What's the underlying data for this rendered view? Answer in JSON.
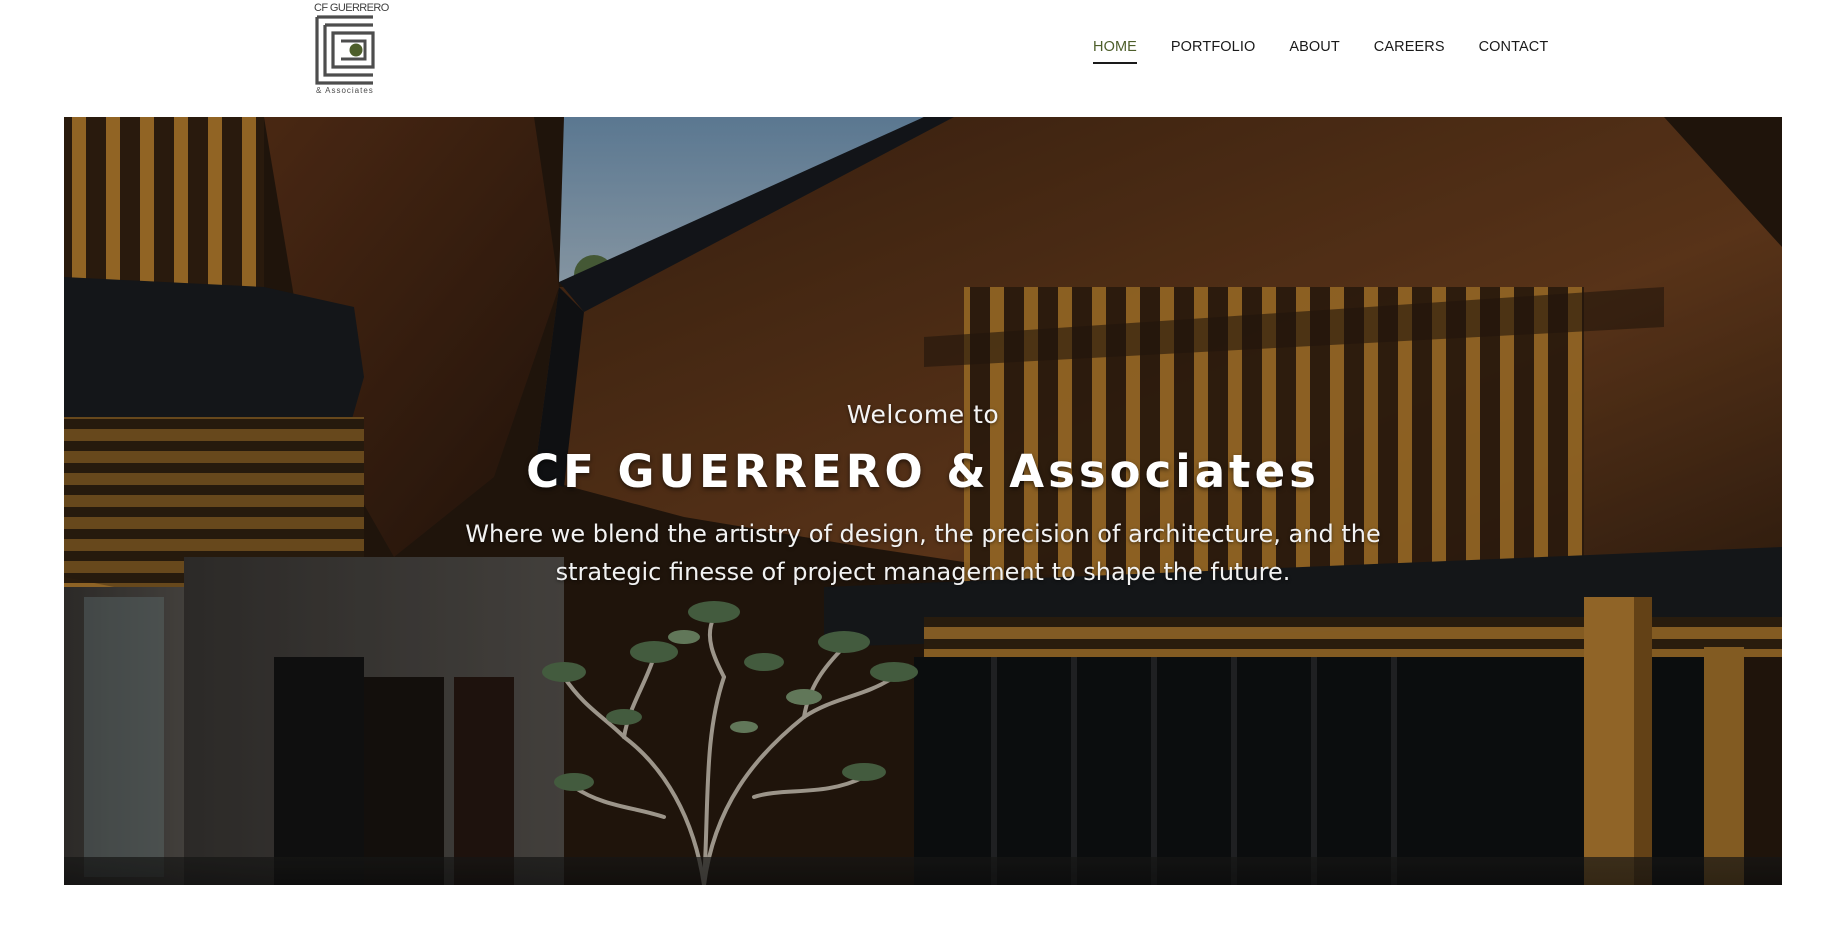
{
  "logo": {
    "top_text": "CF GUERRERO",
    "bottom_text": "& Associates",
    "mark_color": "#4d4d4d",
    "accent_color": "#4d5e2a"
  },
  "nav": {
    "items": [
      {
        "label": "HOME",
        "active": true
      },
      {
        "label": "PORTFOLIO",
        "active": false
      },
      {
        "label": "ABOUT",
        "active": false
      },
      {
        "label": "CAREERS",
        "active": false
      },
      {
        "label": "CONTACT",
        "active": false
      }
    ],
    "active_color": "#4d5e2a"
  },
  "hero": {
    "welcome": "Welcome to",
    "title": "CF GUERRERO & Associates",
    "tagline_line1": "Where we blend the artistry of design, the precision of architecture, and the",
    "tagline_line2": "strategic finesse of project management to shape the future."
  }
}
